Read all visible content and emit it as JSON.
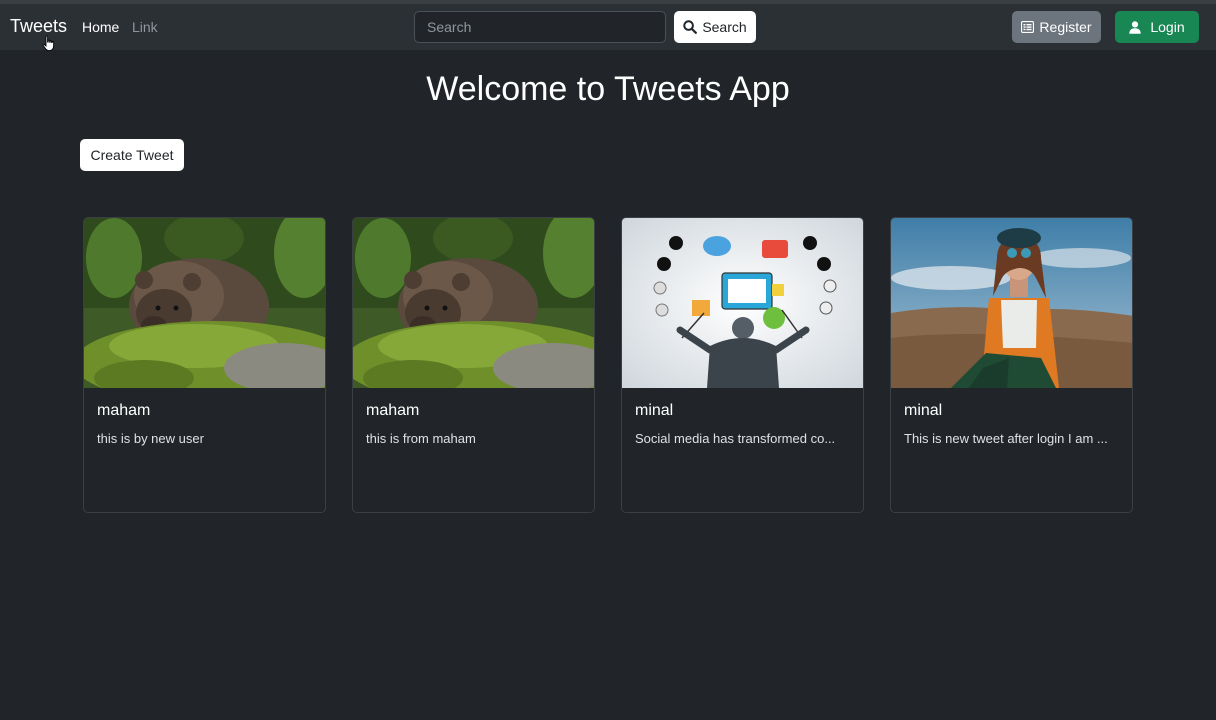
{
  "navbar": {
    "brand": "Tweets",
    "links": [
      "Home",
      "Link"
    ],
    "search_placeholder": "Search",
    "search_button": "Search",
    "register_button": "Register",
    "login_button": "Login"
  },
  "heading": "Welcome to Tweets App",
  "create_button": "Create Tweet",
  "tweets": [
    {
      "author": "maham",
      "text": "this is by new user",
      "image": "bear-photo"
    },
    {
      "author": "maham",
      "text": "this is from maham",
      "image": "bear-photo"
    },
    {
      "author": "minal",
      "text": "Social media has transformed co...",
      "image": "social-media-illustration"
    },
    {
      "author": "minal",
      "text": "This is new tweet after login I am ...",
      "image": "woman-sunglasses-photo"
    }
  ],
  "colors": {
    "background": "#212529",
    "navbar": "#2b3035",
    "register": "#6c757d",
    "login": "#198754"
  }
}
